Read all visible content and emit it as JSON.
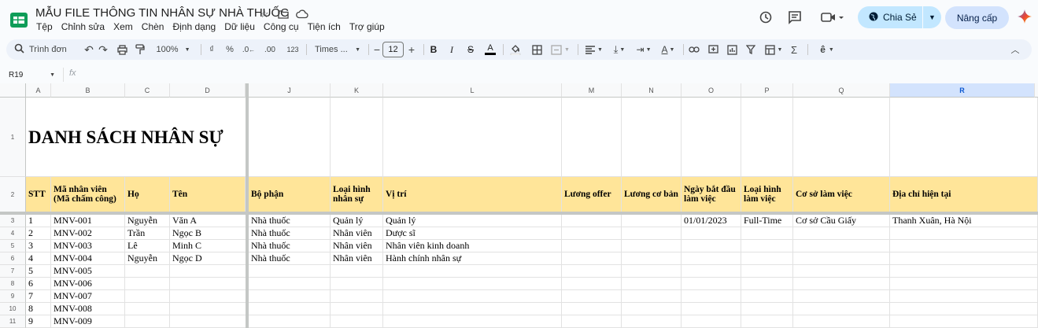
{
  "app": {
    "doc_title": "MẪU FILE THÔNG TIN NHÂN SỰ NHÀ THUỐC",
    "menu": [
      "Tệp",
      "Chỉnh sửa",
      "Xem",
      "Chèn",
      "Định dạng",
      "Dữ liệu",
      "Công cụ",
      "Tiện ích",
      "Trợ giúp"
    ],
    "share_label": "Chia Sẻ",
    "upgrade_label": "Nâng cấp",
    "colors": {
      "accent": "#c2e7ff",
      "header_fill": "#ffe599",
      "sheets_green": "#0f9d58"
    }
  },
  "toolbar": {
    "search_label": "Trình đơn",
    "zoom": "100%",
    "currency": "₫",
    "percent": "%",
    "dec_less": ".0",
    "dec_more": ".00",
    "format_123": "123",
    "font": "Times ...",
    "font_size": "12"
  },
  "formula_bar": {
    "cell_ref": "R19",
    "fx": "fx"
  },
  "columns": [
    "A",
    "B",
    "C",
    "D",
    "J",
    "K",
    "L",
    "M",
    "N",
    "O",
    "P",
    "Q",
    "R"
  ],
  "selected_column": "R",
  "row_numbers": [
    "1",
    "2",
    "3",
    "4",
    "5",
    "6",
    "7",
    "8",
    "9",
    "10",
    "11"
  ],
  "sheet": {
    "title": "DANH SÁCH NHÂN SỰ",
    "headers": [
      "STT",
      "Mã nhân viên (Mã chấm công)",
      "Họ",
      "Tên",
      "Bộ phận",
      "Loại hình nhân sự",
      "Vị trí",
      "Lương offer",
      "Lương cơ bản",
      "Ngày bắt đầu làm việc",
      "Loại hình làm việc",
      "Cơ sở làm việc",
      "Địa chỉ hiện tại"
    ],
    "rows": [
      [
        "1",
        "MNV-001",
        "Nguyễn",
        "Văn A",
        "Nhà thuốc",
        "Quản lý",
        "Quản lý",
        "",
        "",
        "01/01/2023",
        "Full-Time",
        "Cơ sở Cầu Giấy",
        "Thanh Xuân, Hà Nội"
      ],
      [
        "2",
        "MNV-002",
        "Trần",
        "Ngọc B",
        "Nhà thuốc",
        "Nhân viên",
        "Dược sĩ",
        "",
        "",
        "",
        "",
        "",
        ""
      ],
      [
        "3",
        "MNV-003",
        "Lê",
        "Minh C",
        "Nhà thuốc",
        "Nhân viên",
        "Nhân viên kinh doanh",
        "",
        "",
        "",
        "",
        "",
        ""
      ],
      [
        "4",
        "MNV-004",
        "Nguyễn",
        "Ngọc D",
        "Nhà thuốc",
        "Nhân viên",
        "Hành chính nhân sự",
        "",
        "",
        "",
        "",
        "",
        ""
      ],
      [
        "5",
        "MNV-005",
        "",
        "",
        "",
        "",
        "",
        "",
        "",
        "",
        "",
        "",
        ""
      ],
      [
        "6",
        "MNV-006",
        "",
        "",
        "",
        "",
        "",
        "",
        "",
        "",
        "",
        "",
        ""
      ],
      [
        "7",
        "MNV-007",
        "",
        "",
        "",
        "",
        "",
        "",
        "",
        "",
        "",
        "",
        ""
      ],
      [
        "8",
        "MNV-008",
        "",
        "",
        "",
        "",
        "",
        "",
        "",
        "",
        "",
        "",
        ""
      ],
      [
        "9",
        "MNV-009",
        "",
        "",
        "",
        "",
        "",
        "",
        "",
        "",
        "",
        "",
        ""
      ]
    ]
  }
}
